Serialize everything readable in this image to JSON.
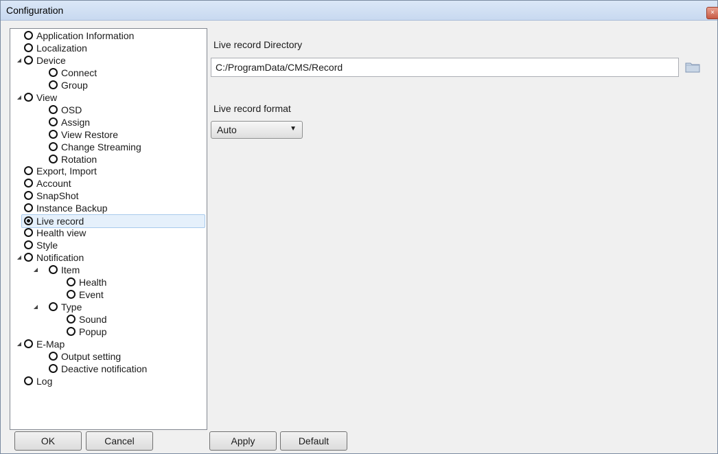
{
  "window": {
    "title": "Configuration",
    "close_glyph": "×"
  },
  "tree": {
    "items": [
      {
        "label": "Application Information",
        "level": 0,
        "expandable": false,
        "selected": false
      },
      {
        "label": "Localization",
        "level": 0,
        "expandable": false,
        "selected": false
      },
      {
        "label": "Device",
        "level": 0,
        "expandable": true,
        "selected": false
      },
      {
        "label": "Connect",
        "level": 1,
        "expandable": false,
        "selected": false
      },
      {
        "label": "Group",
        "level": 1,
        "expandable": false,
        "selected": false
      },
      {
        "label": "View",
        "level": 0,
        "expandable": true,
        "selected": false
      },
      {
        "label": "OSD",
        "level": 1,
        "expandable": false,
        "selected": false
      },
      {
        "label": "Assign",
        "level": 1,
        "expandable": false,
        "selected": false
      },
      {
        "label": "View Restore",
        "level": 1,
        "expandable": false,
        "selected": false
      },
      {
        "label": "Change Streaming",
        "level": 1,
        "expandable": false,
        "selected": false
      },
      {
        "label": "Rotation",
        "level": 1,
        "expandable": false,
        "selected": false
      },
      {
        "label": "Export, Import",
        "level": 0,
        "expandable": false,
        "selected": false
      },
      {
        "label": "Account",
        "level": 0,
        "expandable": false,
        "selected": false
      },
      {
        "label": "SnapShot",
        "level": 0,
        "expandable": false,
        "selected": false
      },
      {
        "label": "Instance Backup",
        "level": 0,
        "expandable": false,
        "selected": false
      },
      {
        "label": "Live record",
        "level": 0,
        "expandable": false,
        "selected": true
      },
      {
        "label": "Health view",
        "level": 0,
        "expandable": false,
        "selected": false
      },
      {
        "label": "Style",
        "level": 0,
        "expandable": false,
        "selected": false
      },
      {
        "label": "Notification",
        "level": 0,
        "expandable": true,
        "selected": false
      },
      {
        "label": "Item",
        "level": 1,
        "expandable": true,
        "selected": false
      },
      {
        "label": "Health",
        "level": 2,
        "expandable": false,
        "selected": false
      },
      {
        "label": "Event",
        "level": 2,
        "expandable": false,
        "selected": false
      },
      {
        "label": "Type",
        "level": 1,
        "expandable": true,
        "selected": false
      },
      {
        "label": "Sound",
        "level": 2,
        "expandable": false,
        "selected": false
      },
      {
        "label": "Popup",
        "level": 2,
        "expandable": false,
        "selected": false
      },
      {
        "label": "E-Map",
        "level": 0,
        "expandable": true,
        "selected": false
      },
      {
        "label": "Output setting",
        "level": 1,
        "expandable": false,
        "selected": false
      },
      {
        "label": "Deactive notification",
        "level": 1,
        "expandable": false,
        "selected": false
      },
      {
        "label": "Log",
        "level": 0,
        "expandable": false,
        "selected": false
      }
    ]
  },
  "live_record": {
    "directory_label": "Live record Directory",
    "directory_value": "C:/ProgramData/CMS/Record",
    "format_label": "Live record format",
    "format_value": "Auto"
  },
  "buttons": {
    "ok": "OK",
    "cancel": "Cancel",
    "apply": "Apply",
    "default": "Default"
  },
  "colors": {
    "selection": "#e5f0fb",
    "selection_border": "#a7c9ec",
    "titlebar": "#c8d9f0"
  }
}
